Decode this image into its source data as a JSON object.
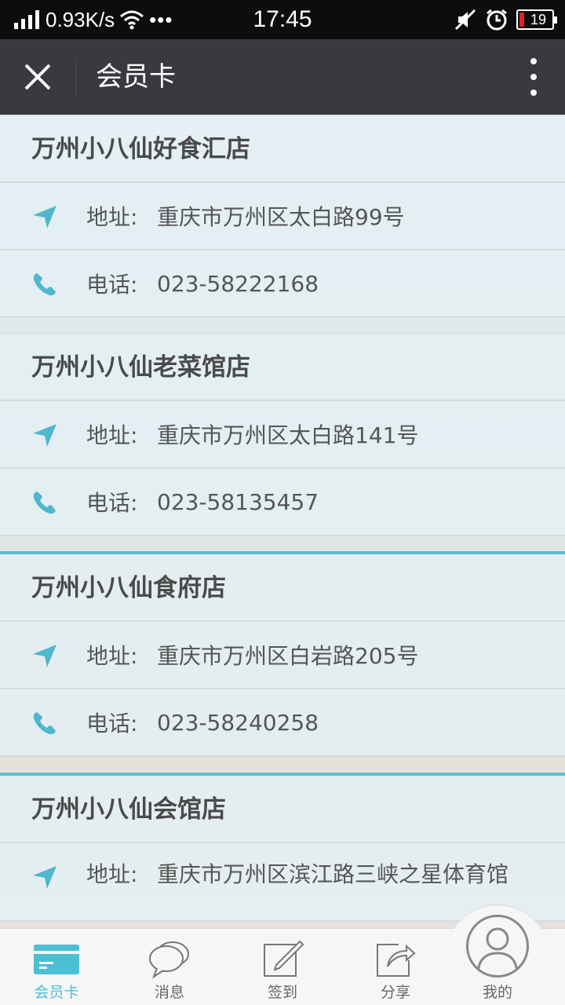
{
  "status_bar": {
    "net_speed": "0.93K/s",
    "dots": "•••",
    "time": "17:45",
    "battery": "19",
    "icons": [
      "signal-icon",
      "wifi-icon",
      "mute-icon",
      "alarm-icon",
      "battery-icon"
    ]
  },
  "header": {
    "title": "会员卡",
    "close_icon": "close-icon",
    "more_icon": "more-vertical-icon"
  },
  "stores": [
    {
      "name": "万州小八仙好食汇店",
      "address_label": "地址:",
      "address": "重庆市万州区太白路99号",
      "phone_label": "电话:",
      "phone": "023-58222168"
    },
    {
      "name": "万州小八仙老菜馆店",
      "address_label": "地址:",
      "address": "重庆市万州区太白路141号",
      "phone_label": "电话:",
      "phone": "023-58135457"
    },
    {
      "name": "万州小八仙食府店",
      "address_label": "地址:",
      "address": "重庆市万州区白岩路205号",
      "phone_label": "电话:",
      "phone": "023-58240258"
    },
    {
      "name": "万州小八仙会馆店",
      "address_label": "地址:",
      "address": "重庆市万州区滨江路三峡之星体育馆"
    }
  ],
  "bottom_nav": {
    "items": [
      {
        "label": "会员卡",
        "icon": "member-card-icon",
        "active": true
      },
      {
        "label": "消息",
        "icon": "message-icon"
      },
      {
        "label": "签到",
        "icon": "sign-in-icon"
      },
      {
        "label": "分享",
        "icon": "share-icon"
      },
      {
        "label": "我的",
        "icon": "profile-icon"
      }
    ]
  },
  "colors": {
    "accent": "#4dbfd2",
    "titlebar": "#393a3f"
  }
}
